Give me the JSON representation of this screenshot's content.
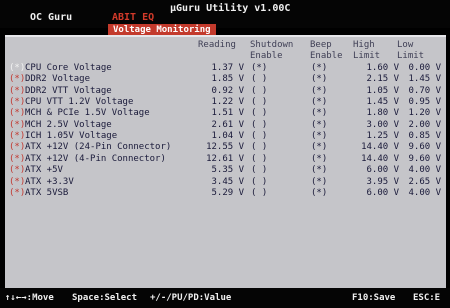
{
  "app_title": "μGuru Utility v1.00C",
  "menu": {
    "oc_guru": "OC Guru",
    "abit_eq": "ABIT EQ"
  },
  "page_tab": "Voltage Monitoring",
  "headers": {
    "reading": "Reading",
    "shutdown": [
      "Shutdown",
      "Enable"
    ],
    "beep": [
      "Beep",
      "Enable"
    ],
    "high": [
      "High",
      "Limit"
    ],
    "low": [
      "Low",
      "Limit"
    ]
  },
  "rows": [
    {
      "mark": "(*)",
      "label": "CPU Core Voltage",
      "reading": "1.37 V",
      "shutdown": "(*)",
      "beep": "(*)",
      "high": "1.60 V",
      "low": "0.00 V"
    },
    {
      "mark": "(*)",
      "label": "DDR2 Voltage",
      "reading": "1.85 V",
      "shutdown": "( )",
      "beep": "(*)",
      "high": "2.15 V",
      "low": "1.45 V"
    },
    {
      "mark": "(*)",
      "label": "DDR2 VTT Voltage",
      "reading": "0.92 V",
      "shutdown": "( )",
      "beep": "(*)",
      "high": "1.05 V",
      "low": "0.70 V"
    },
    {
      "mark": "(*)",
      "label": "CPU VTT 1.2V Voltage",
      "reading": "1.22 V",
      "shutdown": "( )",
      "beep": "(*)",
      "high": "1.45 V",
      "low": "0.95 V"
    },
    {
      "mark": "(*)",
      "label": "MCH & PCIe 1.5V Voltage",
      "reading": "1.51 V",
      "shutdown": "( )",
      "beep": "(*)",
      "high": "1.80 V",
      "low": "1.20 V"
    },
    {
      "mark": "(*)",
      "label": "MCH 2.5V Voltage",
      "reading": "2.61 V",
      "shutdown": "( )",
      "beep": "(*)",
      "high": "3.00 V",
      "low": "2.00 V"
    },
    {
      "mark": "(*)",
      "label": "ICH 1.05V Voltage",
      "reading": "1.04 V",
      "shutdown": "( )",
      "beep": "(*)",
      "high": "1.25 V",
      "low": "0.85 V"
    },
    {
      "mark": "(*)",
      "label": "ATX +12V (24-Pin Connector)",
      "reading": "12.55 V",
      "shutdown": "( )",
      "beep": "(*)",
      "high": "14.40 V",
      "low": "9.60 V"
    },
    {
      "mark": "(*)",
      "label": "ATX +12V (4-Pin Connector)",
      "reading": "12.61 V",
      "shutdown": "( )",
      "beep": "(*)",
      "high": "14.40 V",
      "low": "9.60 V"
    },
    {
      "mark": "(*)",
      "label": "ATX +5V",
      "reading": "5.35 V",
      "shutdown": "( )",
      "beep": "(*)",
      "high": "6.00 V",
      "low": "4.00 V"
    },
    {
      "mark": "(*)",
      "label": "ATX +3.3V",
      "reading": "3.45 V",
      "shutdown": "( )",
      "beep": "(*)",
      "high": "3.95 V",
      "low": "2.65 V"
    },
    {
      "mark": "(*)",
      "label": "ATX 5VSB",
      "reading": "5.29 V",
      "shutdown": "( )",
      "beep": "(*)",
      "high": "6.00 V",
      "low": "4.00 V"
    }
  ],
  "footer": {
    "move": "↑↓←→:Move",
    "select": "Space:Select",
    "value": "+/-/PU/PD:Value",
    "save": "F10:Save",
    "exit": "ESC:E"
  }
}
